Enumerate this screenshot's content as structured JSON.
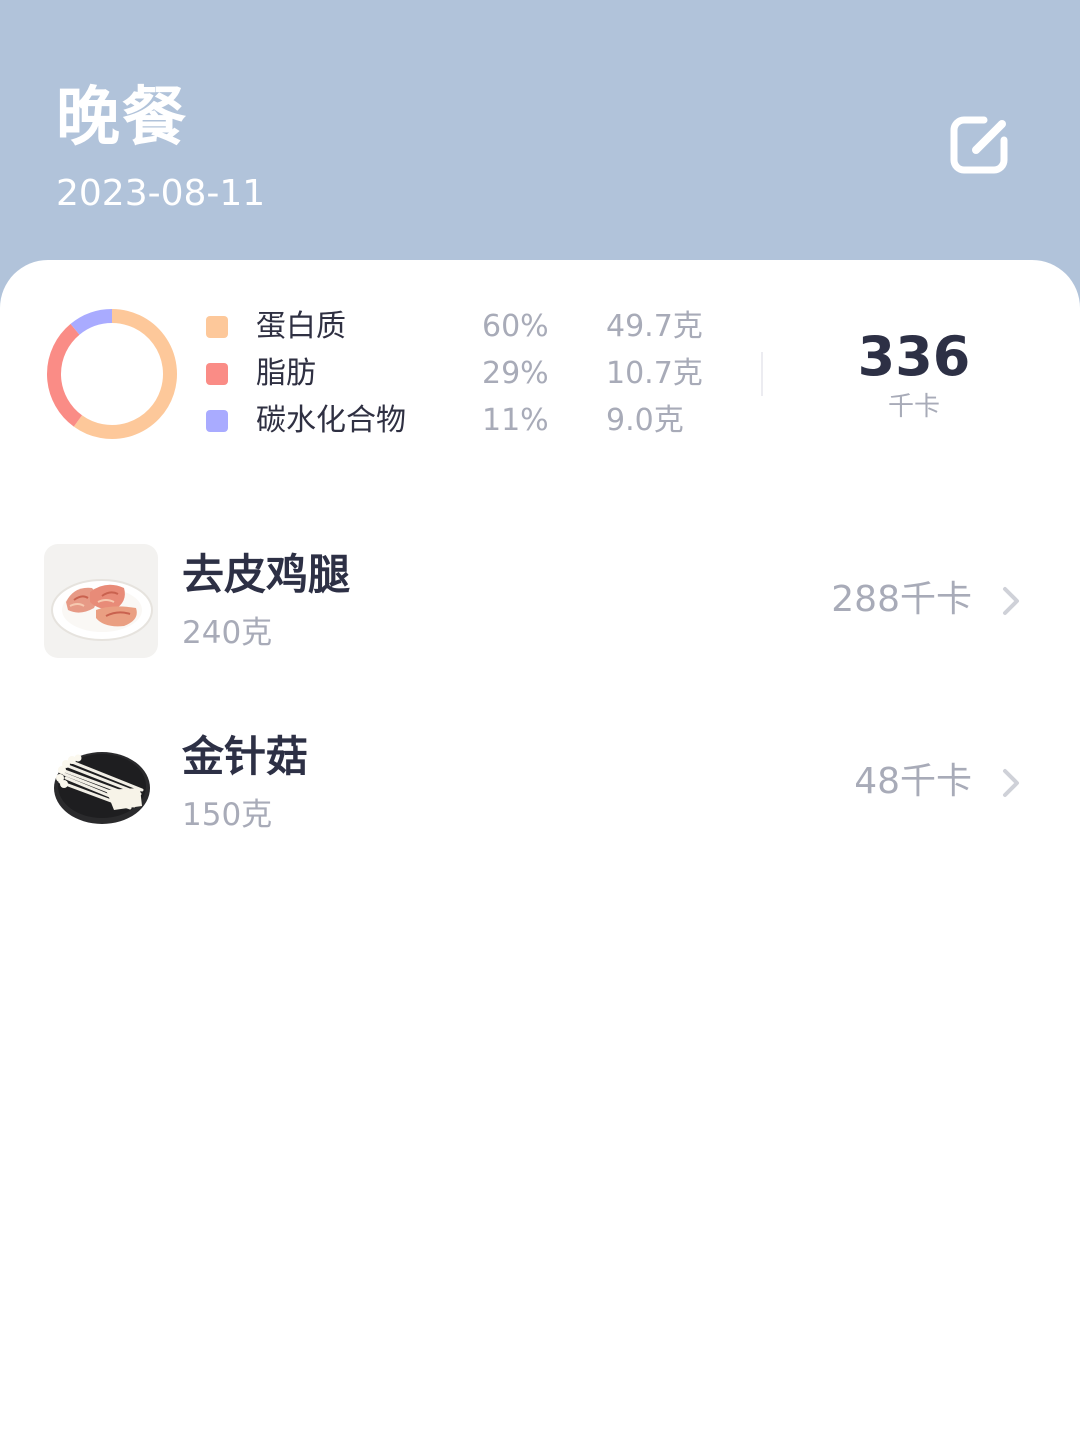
{
  "header": {
    "title": "晚餐",
    "date": "2023-08-11"
  },
  "summary": {
    "macros": [
      {
        "name": "蛋白质",
        "percent": "60%",
        "grams": "49.7克",
        "color": "#fdc89a"
      },
      {
        "name": "脂肪",
        "percent": "29%",
        "grams": "10.7克",
        "color": "#fa8c86"
      },
      {
        "name": "碳水化合物",
        "percent": "11%",
        "grams": "9.0克",
        "color": "#a9abff"
      }
    ],
    "donut_fractions": [
      0.6,
      0.29,
      0.11
    ],
    "total_kcal": "336",
    "kcal_unit": "千卡"
  },
  "foods": [
    {
      "name": "去皮鸡腿",
      "weight": "240克",
      "kcal": "288千卡",
      "icon": "chicken-leg-photo"
    },
    {
      "name": "金针菇",
      "weight": "150克",
      "kcal": "48千卡",
      "icon": "enoki-mushroom-photo"
    }
  ],
  "colors": {
    "header_bg": "#b1c3da",
    "text_dark": "#2d3045",
    "text_muted": "#a8abb8"
  }
}
